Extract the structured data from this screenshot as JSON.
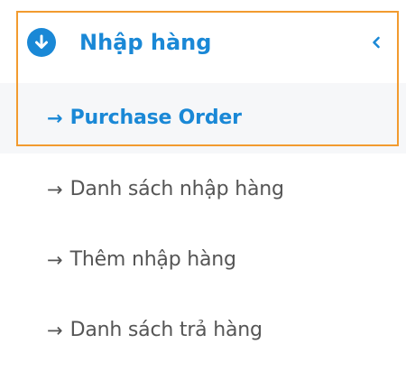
{
  "menu": {
    "header": {
      "label": "Nhập hàng",
      "icon": "arrow-down-circle-icon",
      "chevron_icon": "chevron-left-icon",
      "expanded": true
    },
    "arrow_glyph": "→",
    "items": [
      {
        "label": "Purchase Order",
        "active": true
      },
      {
        "label": "Danh sách nhập hàng",
        "active": false
      },
      {
        "label": "Thêm nhập hàng",
        "active": false
      },
      {
        "label": "Danh sách trả hàng",
        "active": false
      }
    ]
  },
  "colors": {
    "accent": "#1a88d6",
    "highlight_border": "#f29b2f",
    "text_default": "#555555",
    "submenu_background": "#f6f7f9"
  }
}
